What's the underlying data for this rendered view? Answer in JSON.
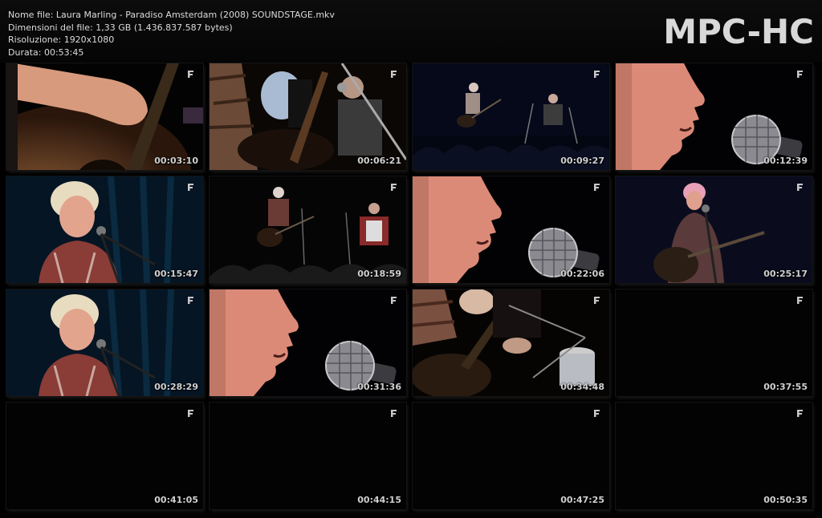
{
  "header": {
    "lines": [
      "Nome file: Laura Marling - Paradiso Amsterdam (2008) SOUNDSTAGE.mkv",
      "Dimensioni del file: 1,33 GB (1.436.837.587 bytes)",
      "Risoluzione: 1920x1080",
      "Durata: 00:53:45"
    ],
    "logo": "MPC-HC"
  },
  "thumbnails": [
    {
      "time": "00:03:10",
      "scene": "guitar-hands-closeup"
    },
    {
      "time": "00:06:21",
      "scene": "guitarists-closeup"
    },
    {
      "time": "00:09:27",
      "scene": "stage-wide-duo"
    },
    {
      "time": "00:12:39",
      "scene": "singer-profile-mic"
    },
    {
      "time": "00:15:47",
      "scene": "singer-at-mic-blue"
    },
    {
      "time": "00:18:59",
      "scene": "stage-wide-guitar-accordion"
    },
    {
      "time": "00:22:06",
      "scene": "singer-profile-mic"
    },
    {
      "time": "00:25:17",
      "scene": "singer-guitar-blue"
    },
    {
      "time": "00:28:29",
      "scene": "singer-at-mic-blue"
    },
    {
      "time": "00:31:36",
      "scene": "singer-profile-mic"
    },
    {
      "time": "00:34:48",
      "scene": "guitar-and-drums-closeup"
    },
    {
      "time": "00:37:55",
      "scene": "black"
    },
    {
      "time": "00:41:05",
      "scene": "black"
    },
    {
      "time": "00:44:15",
      "scene": "black"
    },
    {
      "time": "00:47:25",
      "scene": "black"
    },
    {
      "time": "00:50:35",
      "scene": "black"
    }
  ],
  "colors": {
    "background": "#000000",
    "text": "#dcdcdc",
    "logo": "#d8d8d8"
  },
  "icons": {
    "thumbnail_corner": "film-icon"
  }
}
